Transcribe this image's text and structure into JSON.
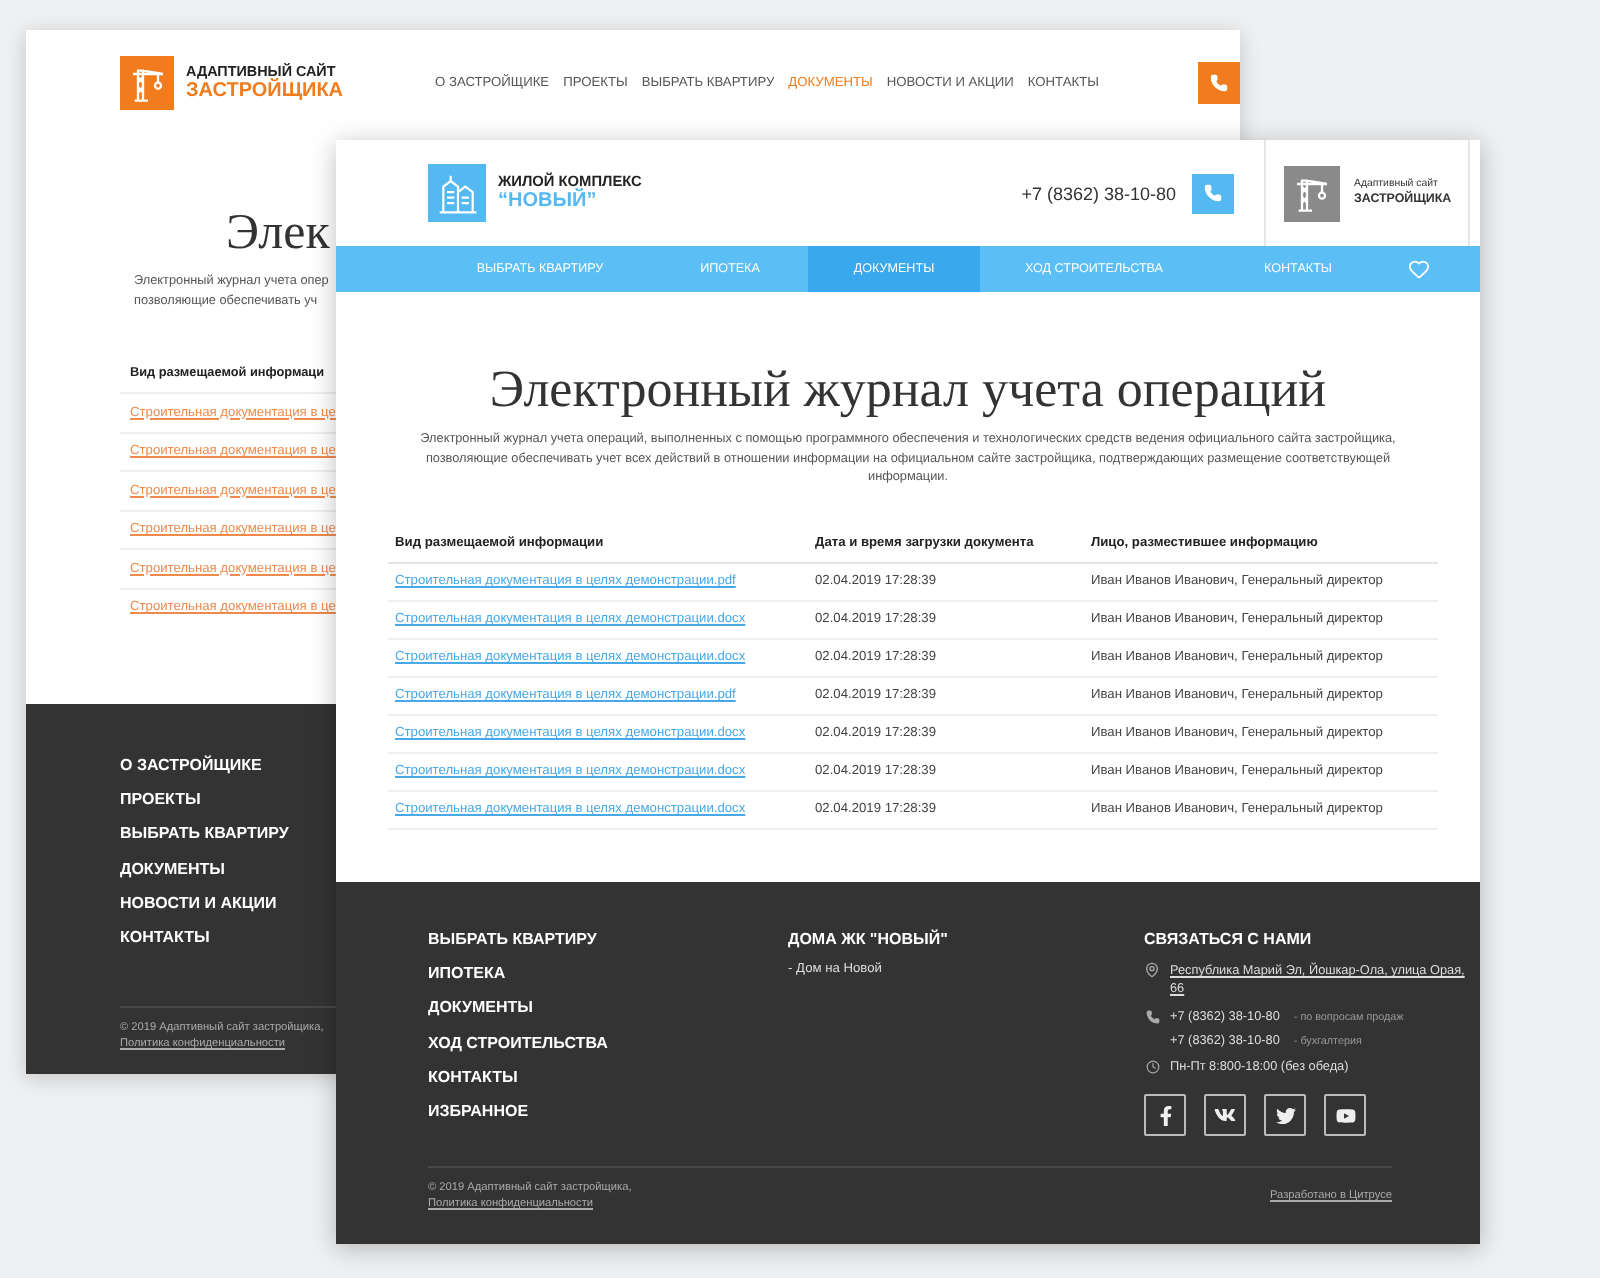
{
  "back_page": {
    "logo": {
      "line1": "АДАПТИВНЫЙ САЙТ",
      "line2": "ЗАСТРОЙЩИКА"
    },
    "nav": [
      {
        "label": "О ЗАСТРОЙЩИКЕ",
        "selected": false
      },
      {
        "label": "ПРОЕКТЫ",
        "selected": false
      },
      {
        "label": "ВЫБРАТЬ КВАРТИРУ",
        "selected": false
      },
      {
        "label": "ДОКУМЕНТЫ",
        "selected": true
      },
      {
        "label": "НОВОСТИ И АКЦИИ",
        "selected": false
      },
      {
        "label": "КОНТАКТЫ",
        "selected": false
      }
    ],
    "title": "Элек",
    "description": [
      "Электронный журнал учета опер",
      "позволяющие обеспечивать уч"
    ],
    "table_heading": "Вид размещаемой информаци",
    "links": [
      "Строительная документация в це",
      "Строительная документация в це",
      "Строительная документация в це",
      "Строительная документация в це",
      "Строительная документация в це",
      "Строительная документация в це"
    ],
    "footer_menu": [
      "О ЗАСТРОЙЩИКЕ",
      "ПРОЕКТЫ",
      "ВЫБРАТЬ КВАРТИРУ",
      "ДОКУМЕНТЫ",
      "НОВОСТИ И АКЦИИ",
      "КОНТАКТЫ"
    ],
    "copyright": "© 2019 Адаптивный сайт застройщика,",
    "privacy": "Политика конфиденциальности"
  },
  "front_page": {
    "logo": {
      "line1": "ЖИЛОЙ КОМПЛЕКС",
      "line2": "“НОВЫЙ”"
    },
    "phone": "+7 (8362) 38-10-80",
    "partner": {
      "line1": "Адаптивный сайт",
      "line2": "ЗАСТРОЙЩИКА"
    },
    "nav": [
      {
        "label": "ВЫБРАТЬ КВАРТИРУ",
        "selected": false
      },
      {
        "label": "ИПОТЕКА",
        "selected": false
      },
      {
        "label": "ДОКУМЕНТЫ",
        "selected": true
      },
      {
        "label": "ХОД СТРОИТЕЛЬСТВА",
        "selected": false
      },
      {
        "label": "КОНТАКТЫ",
        "selected": false
      }
    ],
    "title": "Электронный журнал учета операций",
    "description": "Электронный журнал учета операций, выполненных с помощью программного обеспечения и технологических средств ведения официального сайта застройщика, позволяющие обеспечивать учет всех действий в отношении информации на официальном сайте застройщика, подтверждающих размещение соответствующей информации.",
    "table": {
      "columns": [
        "Вид размещаемой информации",
        "Дата и время загрузки документа",
        "Лицо, разместившее информацию"
      ],
      "rows": [
        [
          "Строительная документация в целях демонстрации.pdf",
          "02.04.2019 17:28:39",
          "Иван Иванов Иванович, Генеральный директор"
        ],
        [
          "Строительная документация в целях демонстрации.docx",
          "02.04.2019 17:28:39",
          "Иван Иванов Иванович, Генеральный директор"
        ],
        [
          "Строительная документация в целях демонстрации.docx",
          "02.04.2019 17:28:39",
          "Иван Иванов Иванович, Генеральный директор"
        ],
        [
          "Строительная документация в целях демонстрации.pdf",
          "02.04.2019 17:28:39",
          "Иван Иванов Иванович, Генеральный директор"
        ],
        [
          "Строительная документация в целях демонстрации.docx",
          "02.04.2019 17:28:39",
          "Иван Иванов Иванович, Генеральный директор"
        ],
        [
          "Строительная документация в целях демонстрации.docx",
          "02.04.2019 17:28:39",
          "Иван Иванов Иванович, Генеральный директор"
        ],
        [
          "Строительная документация в целях демонстрации.docx",
          "02.04.2019 17:28:39",
          "Иван Иванов Иванович, Генеральный директор"
        ]
      ]
    },
    "footer": {
      "menu": [
        "ВЫБРАТЬ КВАРТИРУ",
        "ИПОТЕКА",
        "ДОКУМЕНТЫ",
        "ХОД СТРОИТЕЛЬСТВА",
        "КОНТАКТЫ",
        "ИЗБРАННОЕ"
      ],
      "houses": {
        "heading": "ДОМА ЖК \"НОВЫЙ\"",
        "items": [
          "- Дом на Новой"
        ]
      },
      "contacts": {
        "heading": "СВЯЗАТЬСЯ С НАМИ",
        "address": "Республика Марий Эл, Йошкар-Ола, улица Орая, 66",
        "phones": [
          {
            "number": "+7 (8362) 38-10-80",
            "note": "- по вопросам продаж"
          },
          {
            "number": "+7 (8362) 38-10-80",
            "note": "- бухгалтерия"
          }
        ],
        "hours": "Пн-Пт 8:800-18:00 (без обеда)"
      },
      "copyright": "© 2019 Адаптивный сайт застройщика,",
      "privacy": "Политика конфиденциальности",
      "developer": "Разработано в Цитрусе"
    }
  }
}
